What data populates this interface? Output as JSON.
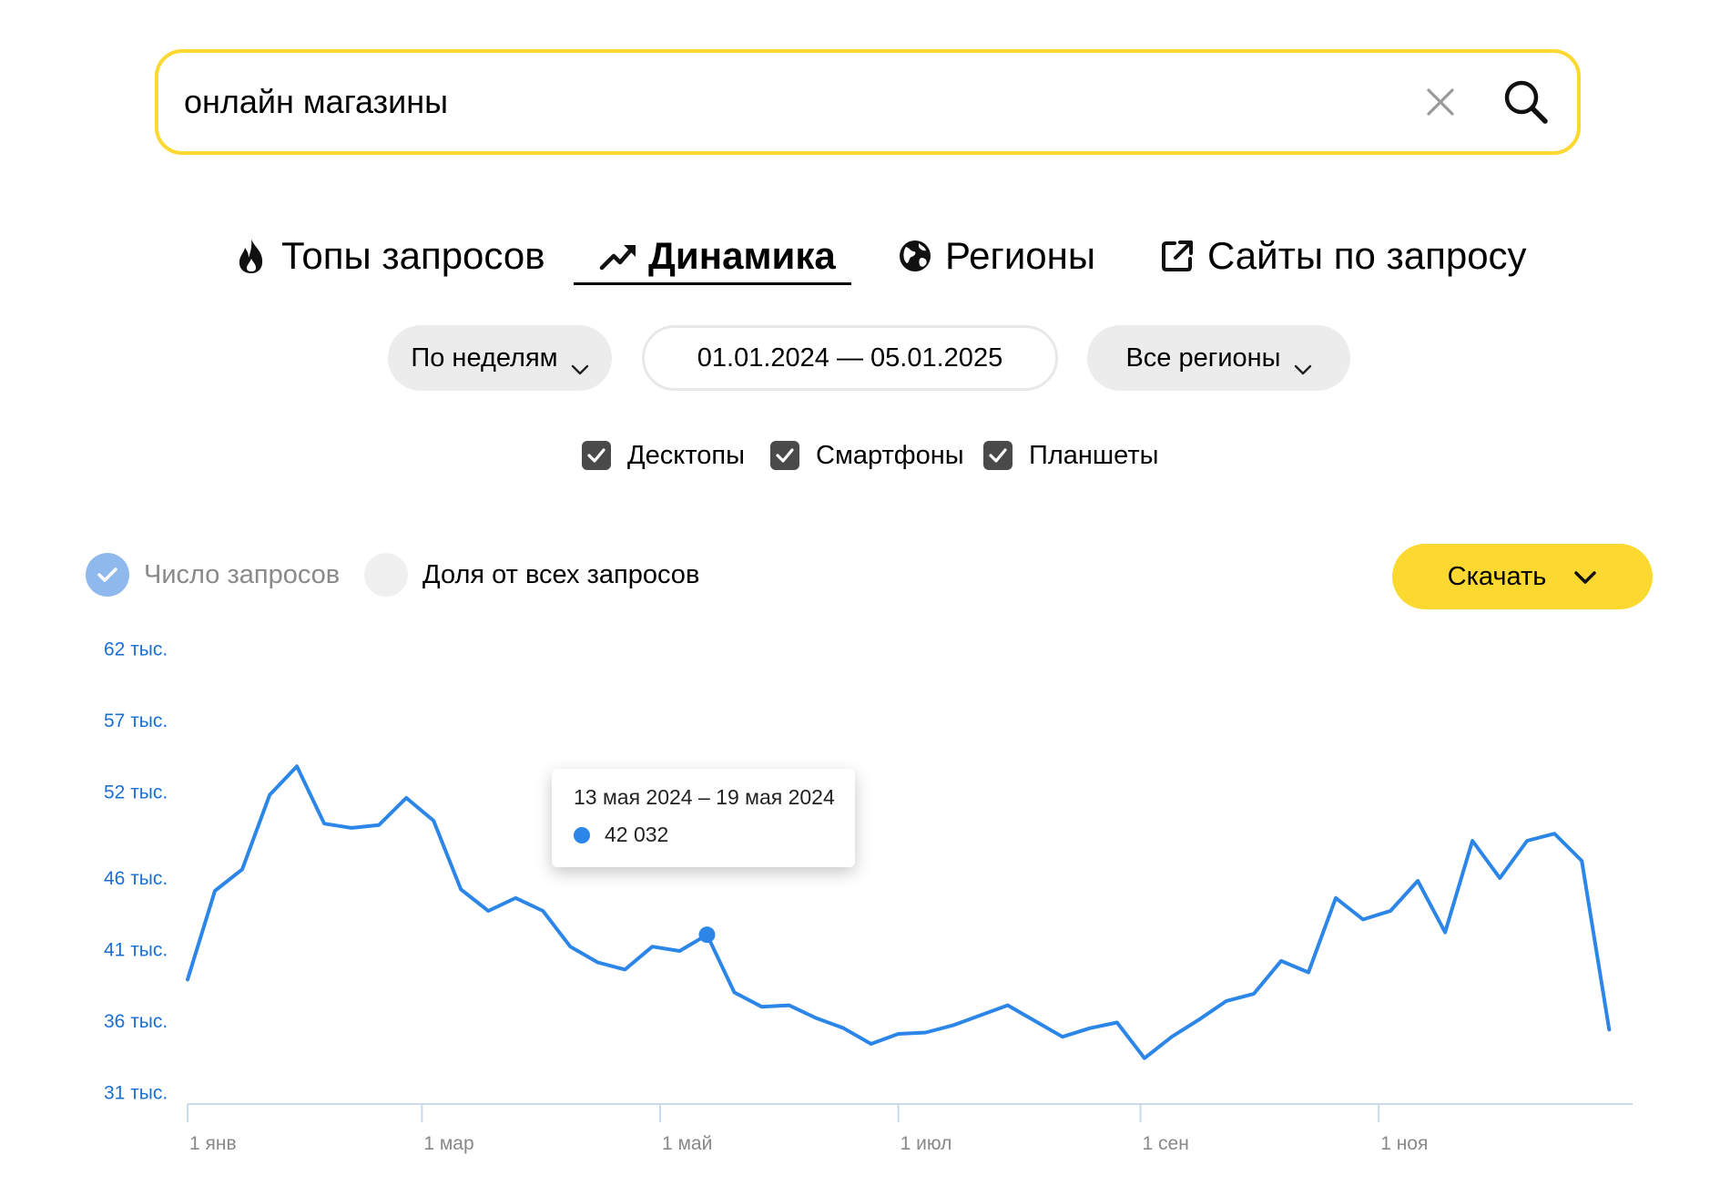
{
  "search": {
    "value": "онлайн магазины",
    "placeholder": ""
  },
  "tabs": [
    {
      "label": "Топы запросов",
      "icon": "fire-icon"
    },
    {
      "label": "Динамика",
      "icon": "trend-up-icon",
      "active": true
    },
    {
      "label": "Регионы",
      "icon": "globe-icon"
    },
    {
      "label": "Сайты по запросу",
      "icon": "external-link-icon"
    }
  ],
  "filters": {
    "period": "По неделям",
    "date_range": "01.01.2024 — 05.01.2025",
    "region": "Все регионы"
  },
  "devices": [
    {
      "label": "Десктопы",
      "checked": true
    },
    {
      "label": "Смартфоны",
      "checked": true
    },
    {
      "label": "Планшеты",
      "checked": true
    }
  ],
  "metrics": {
    "count_label": "Число запросов",
    "share_label": "Доля от всех запросов",
    "selected": "count"
  },
  "download_label": "Скачать",
  "colors": {
    "accent_yellow": "#fcd930",
    "series_blue": "#2b86e8",
    "axis_label_blue": "#1a6fd4"
  },
  "tooltip": {
    "range": "13 мая 2024 – 19 мая 2024",
    "value": "42 032"
  },
  "chart_data": {
    "type": "line",
    "title": "",
    "xlabel": "",
    "ylabel": "",
    "y_ticks": [
      {
        "value": 31000,
        "label": "31 тыс."
      },
      {
        "value": 36000,
        "label": "36 тыс."
      },
      {
        "value": 41000,
        "label": "41 тыс."
      },
      {
        "value": 46000,
        "label": "46 тыс."
      },
      {
        "value": 52000,
        "label": "52 тыс."
      },
      {
        "value": 57000,
        "label": "57 тыс."
      },
      {
        "value": 62000,
        "label": "62 тыс."
      }
    ],
    "x_ticks": [
      {
        "date": "2024-01-01",
        "label": "1 янв"
      },
      {
        "date": "2024-03-01",
        "label": "1 мар"
      },
      {
        "date": "2024-05-01",
        "label": "1 май"
      },
      {
        "date": "2024-07-01",
        "label": "1 июл"
      },
      {
        "date": "2024-09-01",
        "label": "1 сен"
      },
      {
        "date": "2024-11-01",
        "label": "1 ноя"
      }
    ],
    "xlim": [
      "2024-01-01",
      "2025-01-05"
    ],
    "ylim": [
      30200,
      62800
    ],
    "grid": false,
    "highlight_index": 19,
    "series": [
      {
        "x": [
          "2024-01-01",
          "2024-01-08",
          "2024-01-15",
          "2024-01-22",
          "2024-01-29",
          "2024-02-05",
          "2024-02-12",
          "2024-02-19",
          "2024-02-26",
          "2024-03-04",
          "2024-03-11",
          "2024-03-18",
          "2024-03-25",
          "2024-04-01",
          "2024-04-08",
          "2024-04-15",
          "2024-04-22",
          "2024-04-29",
          "2024-05-06",
          "2024-05-13",
          "2024-05-20",
          "2024-05-27",
          "2024-06-03",
          "2024-06-10",
          "2024-06-17",
          "2024-06-24",
          "2024-07-01",
          "2024-07-08",
          "2024-07-15",
          "2024-07-22",
          "2024-07-29",
          "2024-08-05",
          "2024-08-12",
          "2024-08-19",
          "2024-08-26",
          "2024-09-02",
          "2024-09-09",
          "2024-09-16",
          "2024-09-23",
          "2024-09-30",
          "2024-10-07",
          "2024-10-14",
          "2024-10-21",
          "2024-10-28",
          "2024-11-04",
          "2024-11-11",
          "2024-11-18",
          "2024-11-25",
          "2024-12-02",
          "2024-12-09",
          "2024-12-16",
          "2024-12-23",
          "2024-12-30"
        ],
        "values": [
          38900,
          45100,
          46600,
          51800,
          53800,
          49800,
          49500,
          49700,
          51600,
          50000,
          45200,
          43700,
          44600,
          43700,
          41200,
          40100,
          39600,
          41200,
          40900,
          42032,
          38000,
          37000,
          37100,
          36200,
          35500,
          34400,
          35100,
          35200,
          35700,
          36400,
          37100,
          36000,
          34900,
          35500,
          35900,
          33400,
          34900,
          36100,
          37400,
          37900,
          40200,
          39400,
          44600,
          43100,
          43700,
          45800,
          42200,
          48600,
          46000,
          48600,
          49100,
          47200,
          35400
        ]
      }
    ]
  }
}
